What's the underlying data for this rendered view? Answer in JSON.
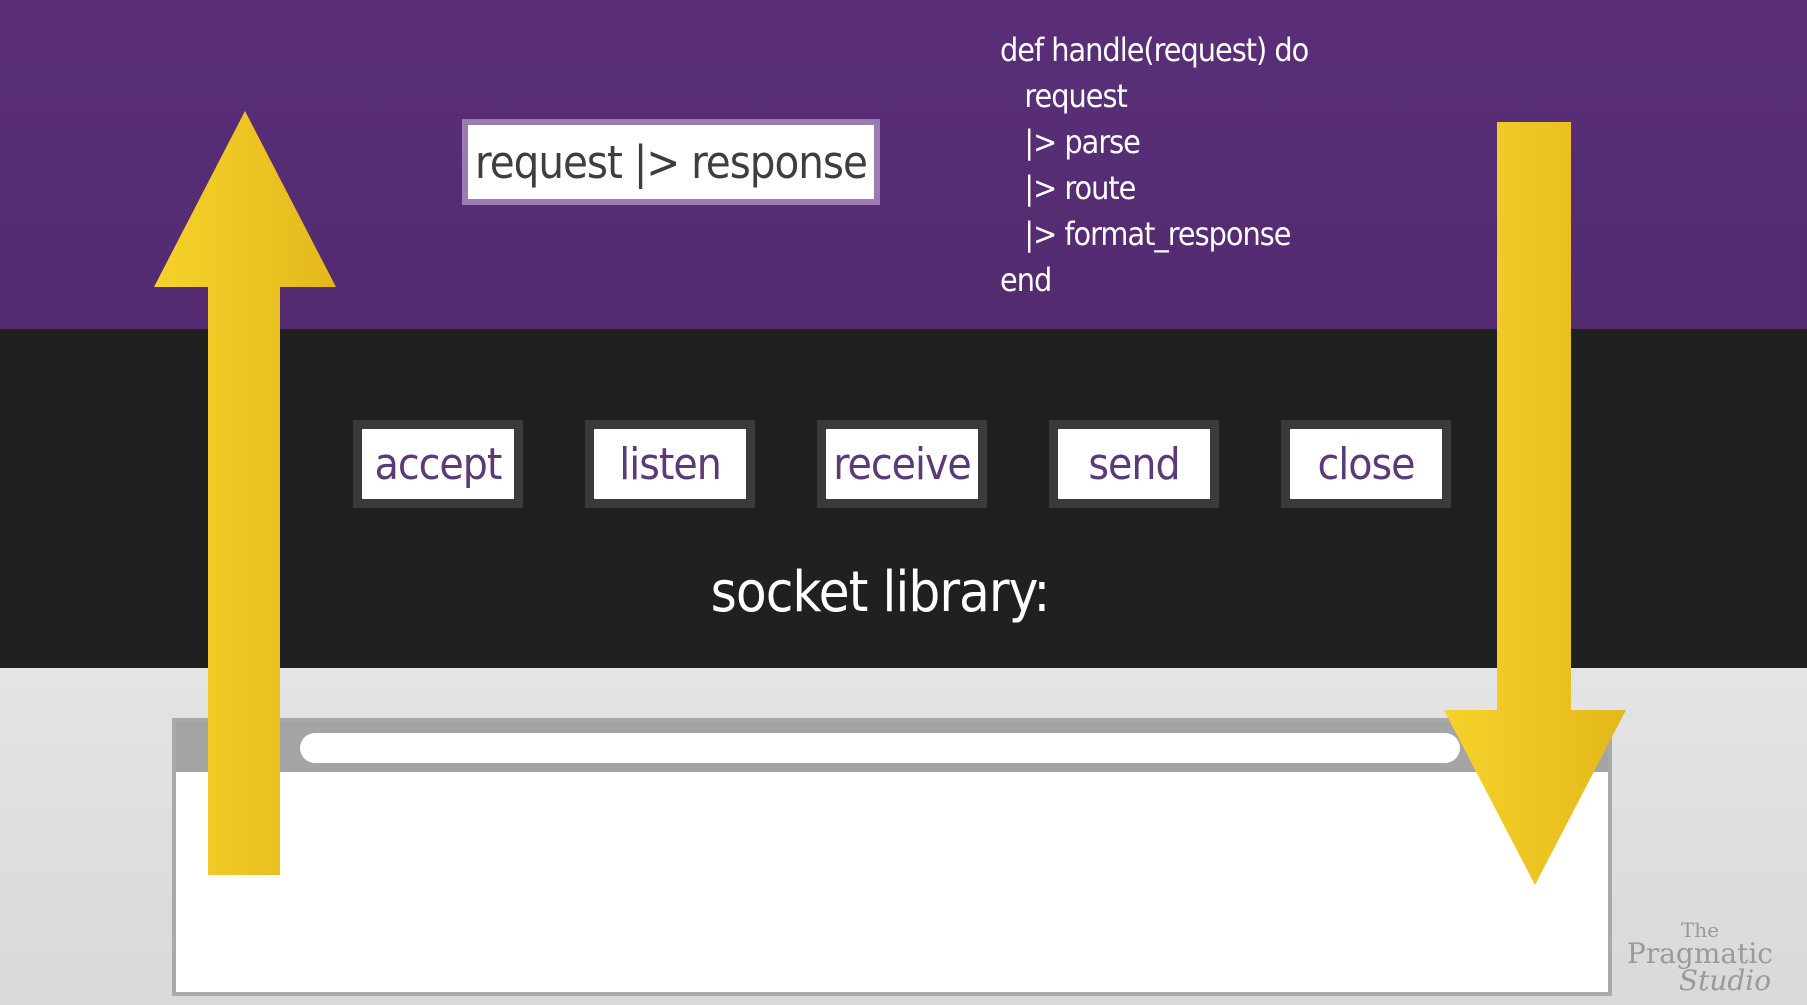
{
  "pipeline": {
    "text": "request |> response"
  },
  "code": {
    "lines": [
      "def handle(request) do",
      "   request",
      "   |> parse",
      "   |> route",
      "   |> format_response",
      "end"
    ]
  },
  "socket_functions": [
    "accept",
    "listen",
    "receive",
    "send",
    "close"
  ],
  "socket_label": "socket library:",
  "watermark": {
    "line1": "The",
    "line2": "Pragmatic",
    "line3": "Studio"
  },
  "colors": {
    "purple_band": "#5a2f78",
    "dark_band": "#202020",
    "light_band": "#dedede",
    "arrow_yellow": "#f2c81e",
    "chip_text": "#5b3a78"
  },
  "arrows": [
    {
      "name": "up-arrow",
      "direction": "up"
    },
    {
      "name": "down-arrow",
      "direction": "down"
    }
  ]
}
